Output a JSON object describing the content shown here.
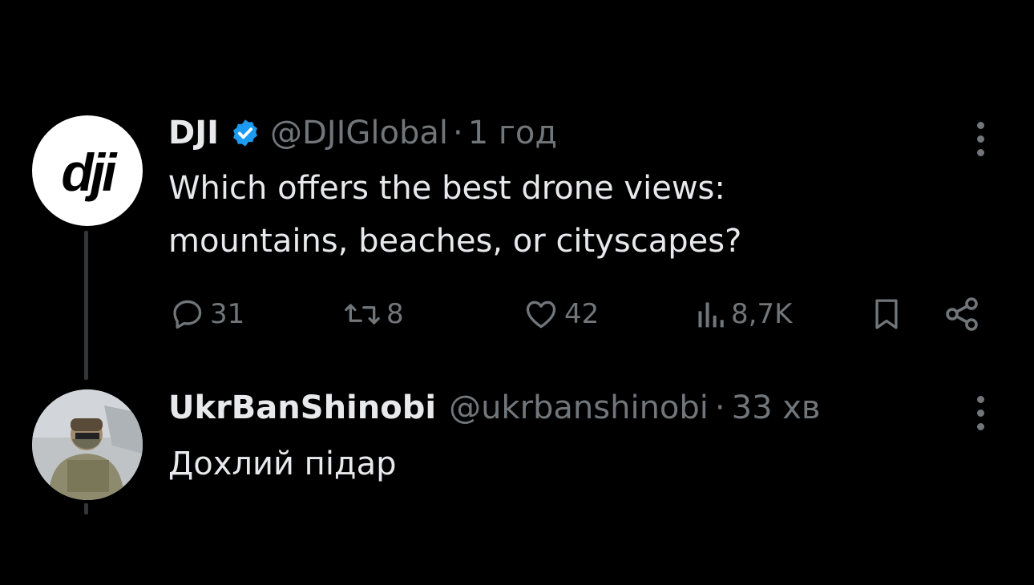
{
  "tweet": {
    "author_name": "DJI",
    "handle": "@DJIGlobal",
    "separator": "·",
    "time": "1 год",
    "logo_text": "dji",
    "text_lines": [
      "Which offers the best drone views:",
      "mountains, beaches, or cityscapes?"
    ],
    "actions": {
      "replies": "31",
      "retweets": "8",
      "likes": "42",
      "views": "8,7K"
    }
  },
  "reply": {
    "author_name": "UkrBanShinobi",
    "handle": "@ukrbanshinobi",
    "separator": "·",
    "time": "33 хв",
    "text": "Дохлий підар"
  },
  "colors": {
    "background": "#000000",
    "text_primary": "#e7e9ea",
    "text_secondary": "#71767b",
    "verified_badge": "#1d9bf0"
  }
}
